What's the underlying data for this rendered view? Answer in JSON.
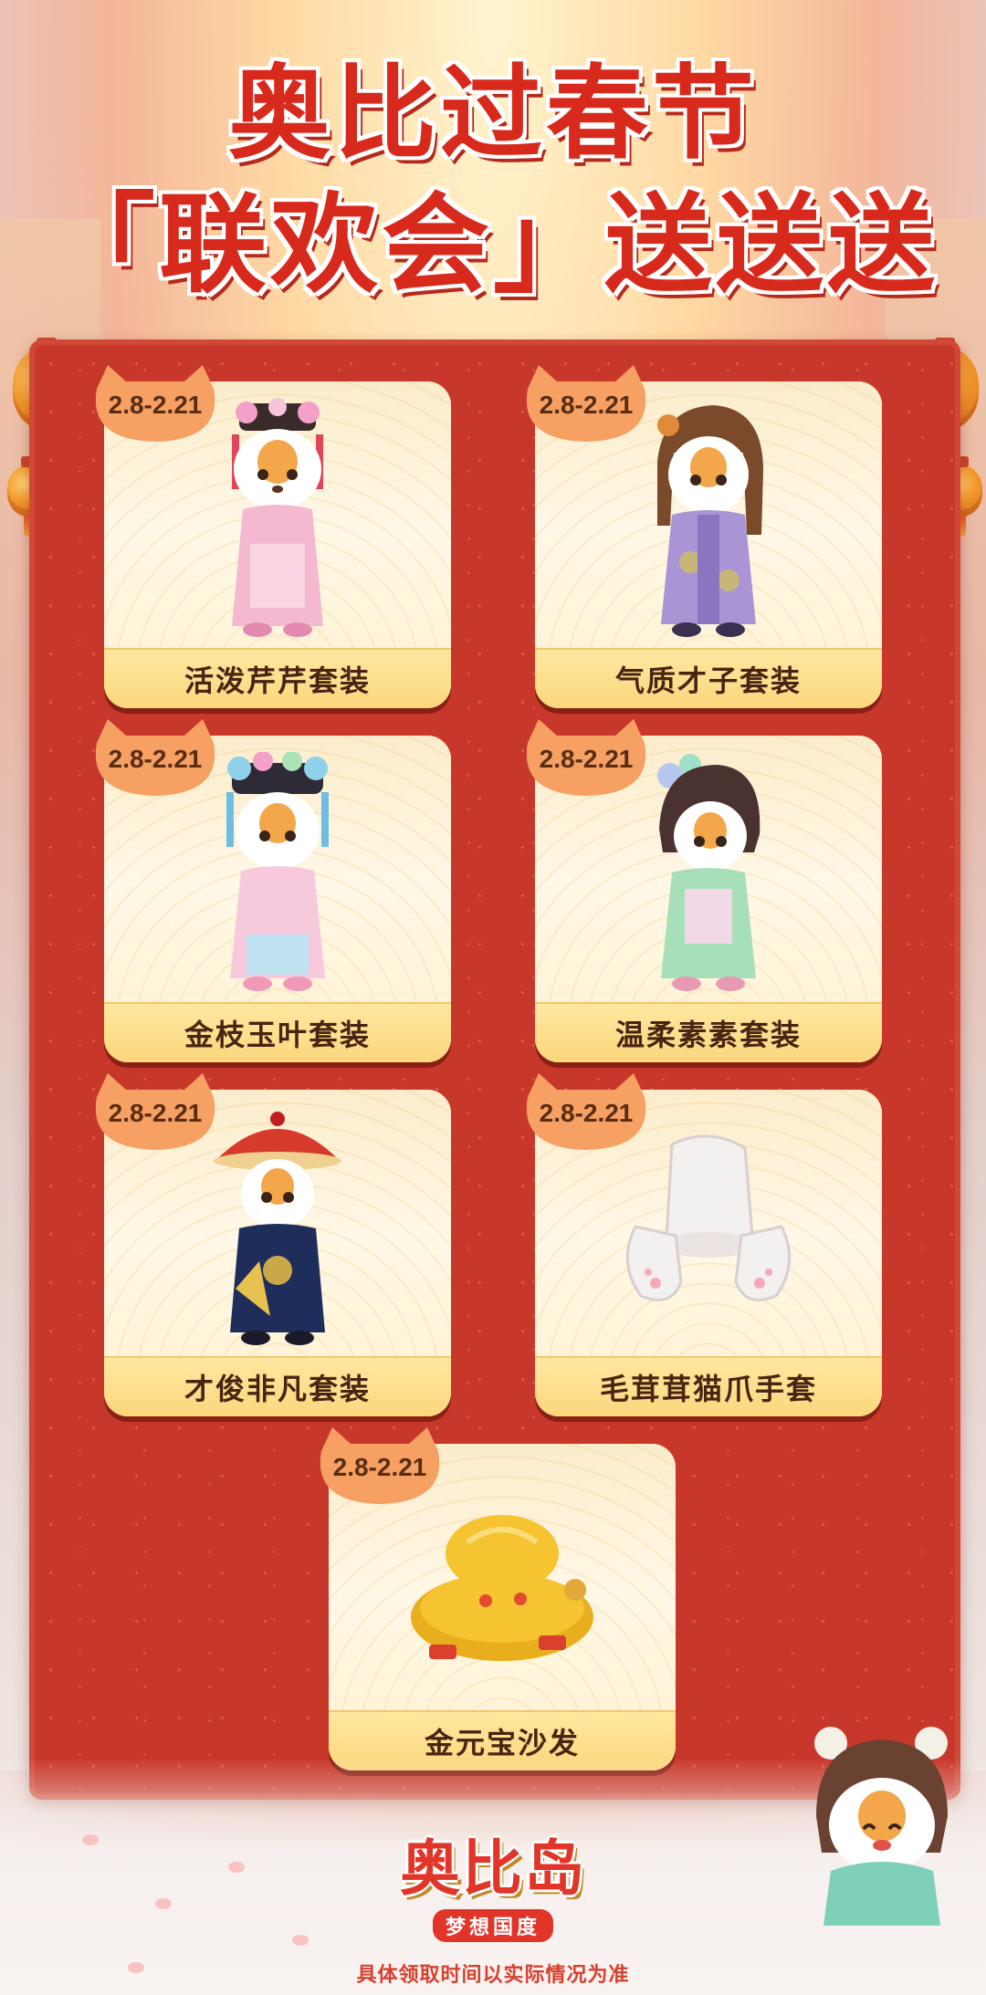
{
  "title": {
    "line1": "奥比过春节",
    "line2": "「联欢会」送送送"
  },
  "items": [
    {
      "date": "2.8-2.21",
      "label": "活泼芹芹套装",
      "icon": "girl-pink-qing-dress-icon"
    },
    {
      "date": "2.8-2.21",
      "label": "气质才子套装",
      "icon": "scholar-purple-robe-icon"
    },
    {
      "date": "2.8-2.21",
      "label": "金枝玉叶套装",
      "icon": "princess-flower-headdress-icon"
    },
    {
      "date": "2.8-2.21",
      "label": "温柔素素套装",
      "icon": "lady-green-dress-icon"
    },
    {
      "date": "2.8-2.21",
      "label": "才俊非凡套装",
      "icon": "official-red-hat-robe-icon"
    },
    {
      "date": "2.8-2.21",
      "label": "毛茸茸猫爪手套",
      "icon": "fluffy-cat-paw-gloves-icon"
    },
    {
      "date": "2.8-2.21",
      "label": "金元宝沙发",
      "icon": "gold-ingot-sofa-icon"
    }
  ],
  "logo": {
    "main": "奥比岛",
    "sub": "梦想国度"
  },
  "disclaimer": "具体领取时间以实际情况为准",
  "colors": {
    "title_red": "#d82a1c",
    "board_red": "#c8382a",
    "card_cream": "#fff6de",
    "label_gold": "#fbd77d"
  }
}
